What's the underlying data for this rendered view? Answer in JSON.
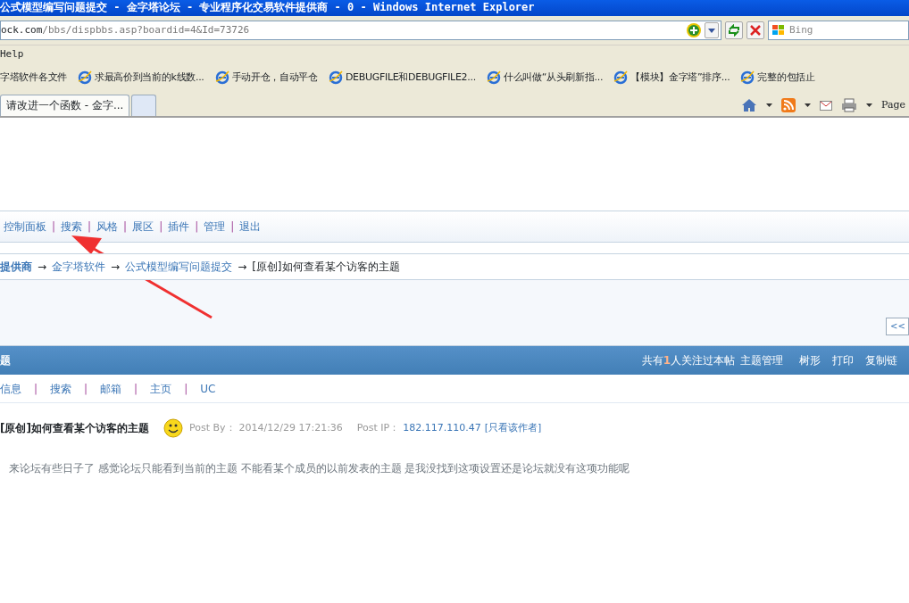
{
  "window": {
    "title": "公式模型编写问题提交 - 金字塔论坛 - 专业程序化交易软件提供商 - 0 - Windows Internet Explorer"
  },
  "address_bar": {
    "url_host": "ock.com",
    "url_path": "/bbs/dispbbs.asp?boardid=4&Id=73726",
    "search_placeholder": "Bing"
  },
  "menu": [
    "Help"
  ],
  "favorites": [
    {
      "label": "字塔软件各文件",
      "kind": "folder"
    },
    {
      "label": "求最高价到当前的k线数...",
      "kind": "page"
    },
    {
      "label": "手动开仓，自动平仓",
      "kind": "page"
    },
    {
      "label": "DEBUGFILE和DEBUGFILE2...",
      "kind": "page"
    },
    {
      "label": "什么叫做“从头刷新指...",
      "kind": "page"
    },
    {
      "label": "【模块】金字塔”排序...",
      "kind": "page"
    },
    {
      "label": "完整的包括止",
      "kind": "page"
    }
  ],
  "tabs": [
    {
      "label": "请改进一个函数 - 金字...",
      "selected": true
    },
    {
      "selected": false
    }
  ],
  "command_bar": {
    "page_label": "Page"
  },
  "forum_nav": [
    "控制面板",
    "|",
    "搜索",
    "|",
    "风格",
    "|",
    "展区",
    "|",
    "插件",
    "|",
    "管理",
    "|",
    "退出"
  ],
  "breadcrumb": {
    "root": "提供商",
    "arrow": "→",
    "links": [
      "金字塔软件",
      "公式模型编写问题提交"
    ],
    "current": "[原创]如何查看某个访客的主题"
  },
  "pager_button": "<<",
  "topic_bar": {
    "title": "题",
    "watch_prefix": "共有",
    "watch_count": "1",
    "watch_suffix": "人关注过本帖",
    "actions": [
      "主题管理",
      "树形",
      "打印",
      "复制链"
    ]
  },
  "user_links": [
    "信息",
    "|",
    "搜索",
    "|",
    "邮箱",
    "|",
    "主页",
    "|",
    "UC"
  ],
  "post": {
    "title": "[原创]如何查看某个访客的主题",
    "by_label": "Post By：",
    "time": "2014/12/29 17:21:36",
    "ip_label": "Post IP：",
    "ip": "182.117.110.47",
    "author_only": "[只看该作者]",
    "body": "来论坛有些日子了 感觉论坛只能看到当前的主题 不能看某个成员的以前发表的主题 是我没找到这项设置还是论坛就没有这项功能呢"
  }
}
